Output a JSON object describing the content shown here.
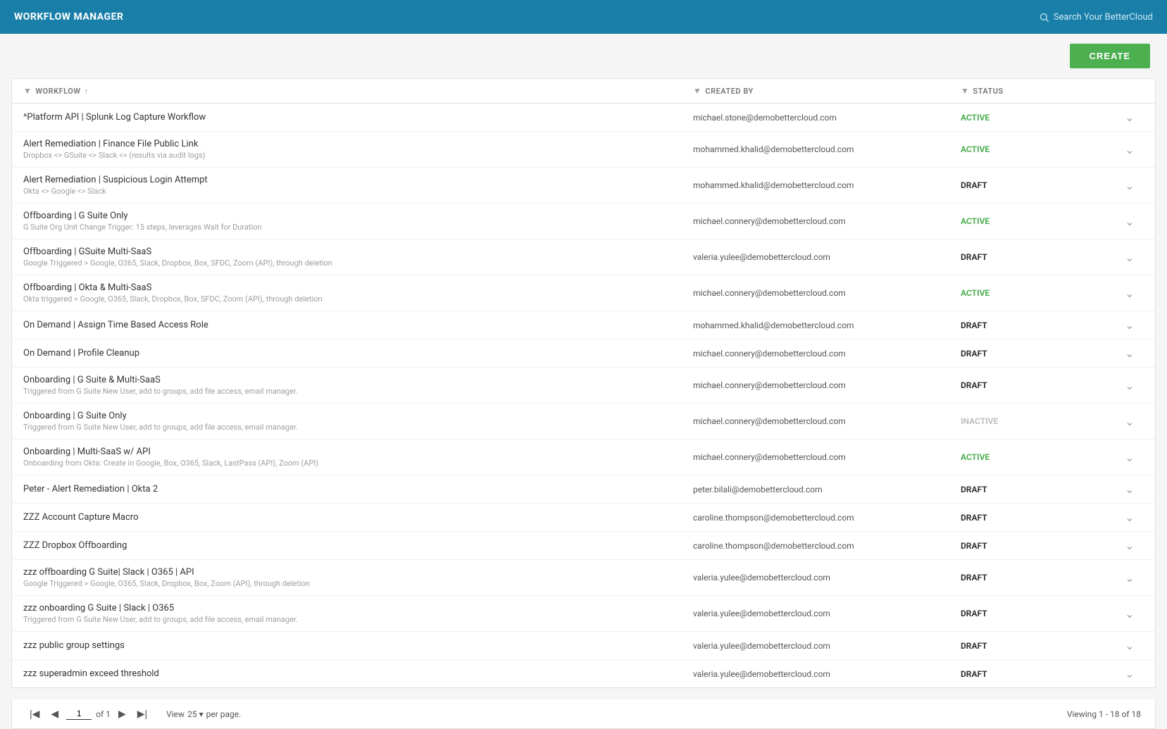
{
  "topnav": {
    "title": "WORKFLOW MANAGER",
    "search_placeholder": "Search Your BetterCloud"
  },
  "action_bar": {
    "create_label": "CREATE"
  },
  "table": {
    "columns": {
      "workflow": "WORKFLOW",
      "created_by": "CREATED BY",
      "status": "STATUS"
    },
    "rows": [
      {
        "name": "^Platform API | Splunk Log Capture Workflow",
        "description": "",
        "created_by": "michael.stone@demobettercloud.com",
        "status": "ACTIVE",
        "status_type": "active"
      },
      {
        "name": "Alert Remediation | Finance File Public Link",
        "description": "Dropbox <> GSuite <> Slack <> (results via audit logs)",
        "created_by": "mohammed.khalid@demobettercloud.com",
        "status": "ACTIVE",
        "status_type": "active"
      },
      {
        "name": "Alert Remediation | Suspicious Login Attempt",
        "description": "Okta <> Google <> Slack",
        "created_by": "mohammed.khalid@demobettercloud.com",
        "status": "DRAFT",
        "status_type": "draft"
      },
      {
        "name": "Offboarding | G Suite Only",
        "description": "G Suite Org Unit Change Trigger: 15 steps, leverages Wait for Duration",
        "created_by": "michael.connery@demobettercloud.com",
        "status": "ACTIVE",
        "status_type": "active"
      },
      {
        "name": "Offboarding | GSuite Multi-SaaS",
        "description": "Google Triggered > Google, O365, Slack, Dropbox, Box, SFDC, Zoom (API), through deletion",
        "created_by": "valeria.yulee@demobettercloud.com",
        "status": "DRAFT",
        "status_type": "draft"
      },
      {
        "name": "Offboarding | Okta & Multi-SaaS",
        "description": "Okta triggered > Google, O365, Slack, Dropbox, Box, SFDC, Zoom (API), through deletion",
        "created_by": "michael.connery@demobettercloud.com",
        "status": "ACTIVE",
        "status_type": "active"
      },
      {
        "name": "On Demand | Assign Time Based Access Role",
        "description": "",
        "created_by": "mohammed.khalid@demobettercloud.com",
        "status": "DRAFT",
        "status_type": "draft"
      },
      {
        "name": "On Demand | Profile Cleanup",
        "description": "",
        "created_by": "michael.connery@demobettercloud.com",
        "status": "DRAFT",
        "status_type": "draft"
      },
      {
        "name": "Onboarding | G Suite & Multi-SaaS",
        "description": "Triggered from G Suite New User, add to groups, add file access, email manager.",
        "created_by": "michael.connery@demobettercloud.com",
        "status": "DRAFT",
        "status_type": "draft"
      },
      {
        "name": "Onboarding | G Suite Only",
        "description": "Triggered from G Suite New User, add to groups, add file access, email manager.",
        "created_by": "michael.connery@demobettercloud.com",
        "status": "INACTIVE",
        "status_type": "inactive"
      },
      {
        "name": "Onboarding | Multi-SaaS w/ API",
        "description": "Onboarding from Okta: Create in Google, Box, O365, Slack, LastPass (API), Zoom (API)",
        "created_by": "michael.connery@demobettercloud.com",
        "status": "ACTIVE",
        "status_type": "active"
      },
      {
        "name": "Peter - Alert Remediation | Okta 2",
        "description": "",
        "created_by": "peter.bilali@demobettercloud.com",
        "status": "DRAFT",
        "status_type": "draft"
      },
      {
        "name": "ZZZ Account Capture Macro",
        "description": "",
        "created_by": "caroline.thompson@demobettercloud.com",
        "status": "DRAFT",
        "status_type": "draft"
      },
      {
        "name": "ZZZ Dropbox Offboarding",
        "description": "",
        "created_by": "caroline.thompson@demobettercloud.com",
        "status": "DRAFT",
        "status_type": "draft"
      },
      {
        "name": "zzz offboarding G Suite| Slack | O365 | API",
        "description": "Google Triggered > Google, O365, Slack, Dropbox, Box, Zoom (API), through deletion",
        "created_by": "valeria.yulee@demobettercloud.com",
        "status": "DRAFT",
        "status_type": "draft"
      },
      {
        "name": "zzz onboarding G Suite | Slack | O365",
        "description": "Triggered from G Suite New User, add to groups, add file access, email manager.",
        "created_by": "valeria.yulee@demobettercloud.com",
        "status": "DRAFT",
        "status_type": "draft"
      },
      {
        "name": "zzz public group settings",
        "description": "",
        "created_by": "valeria.yulee@demobettercloud.com",
        "status": "DRAFT",
        "status_type": "draft"
      },
      {
        "name": "zzz superadmin exceed threshold",
        "description": "",
        "created_by": "valeria.yulee@demobettercloud.com",
        "status": "DRAFT",
        "status_type": "draft"
      }
    ]
  },
  "pagination": {
    "current_page": "1",
    "of_label": "of 1",
    "per_page_label": "View",
    "per_page_value": "25",
    "per_page_suffix": "per page.",
    "viewing_text": "Viewing 1 - 18 of 18"
  }
}
